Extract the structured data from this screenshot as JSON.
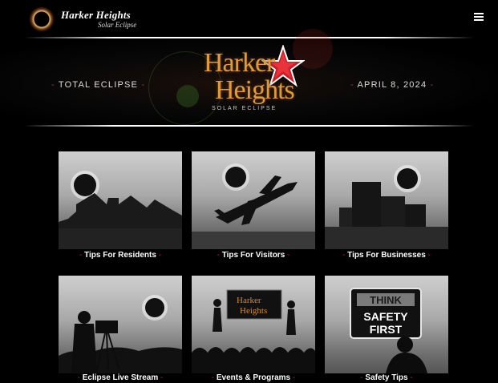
{
  "header": {
    "logo_line1": "Harker Heights",
    "logo_line2": "Solar Eclipse",
    "menu_icon": "hamburger-icon"
  },
  "hero": {
    "left_text": "TOTAL ECLIPSE",
    "right_text": "APRIL 8, 2024",
    "logo_word1": "Harker",
    "logo_word2": "Heights",
    "logo_tagline": "SOLAR   ECLIPSE"
  },
  "tiles": [
    {
      "label": "Tips For Residents"
    },
    {
      "label": "Tips For Visitors"
    },
    {
      "label": "Tips For Businesses"
    },
    {
      "label": "Eclipse Live Stream"
    },
    {
      "label": "Events & Programs"
    },
    {
      "label": "Safety Tips"
    }
  ],
  "safety_sign": {
    "line1": "THINK",
    "line2": "SAFETY",
    "line3": "FIRST"
  },
  "screen_sign": {
    "line1": "Harker",
    "line2": "Heights"
  },
  "colors": {
    "accent_dash": "#b22222",
    "logo_orange": "#e09a3a",
    "star_red": "#c8202a"
  }
}
